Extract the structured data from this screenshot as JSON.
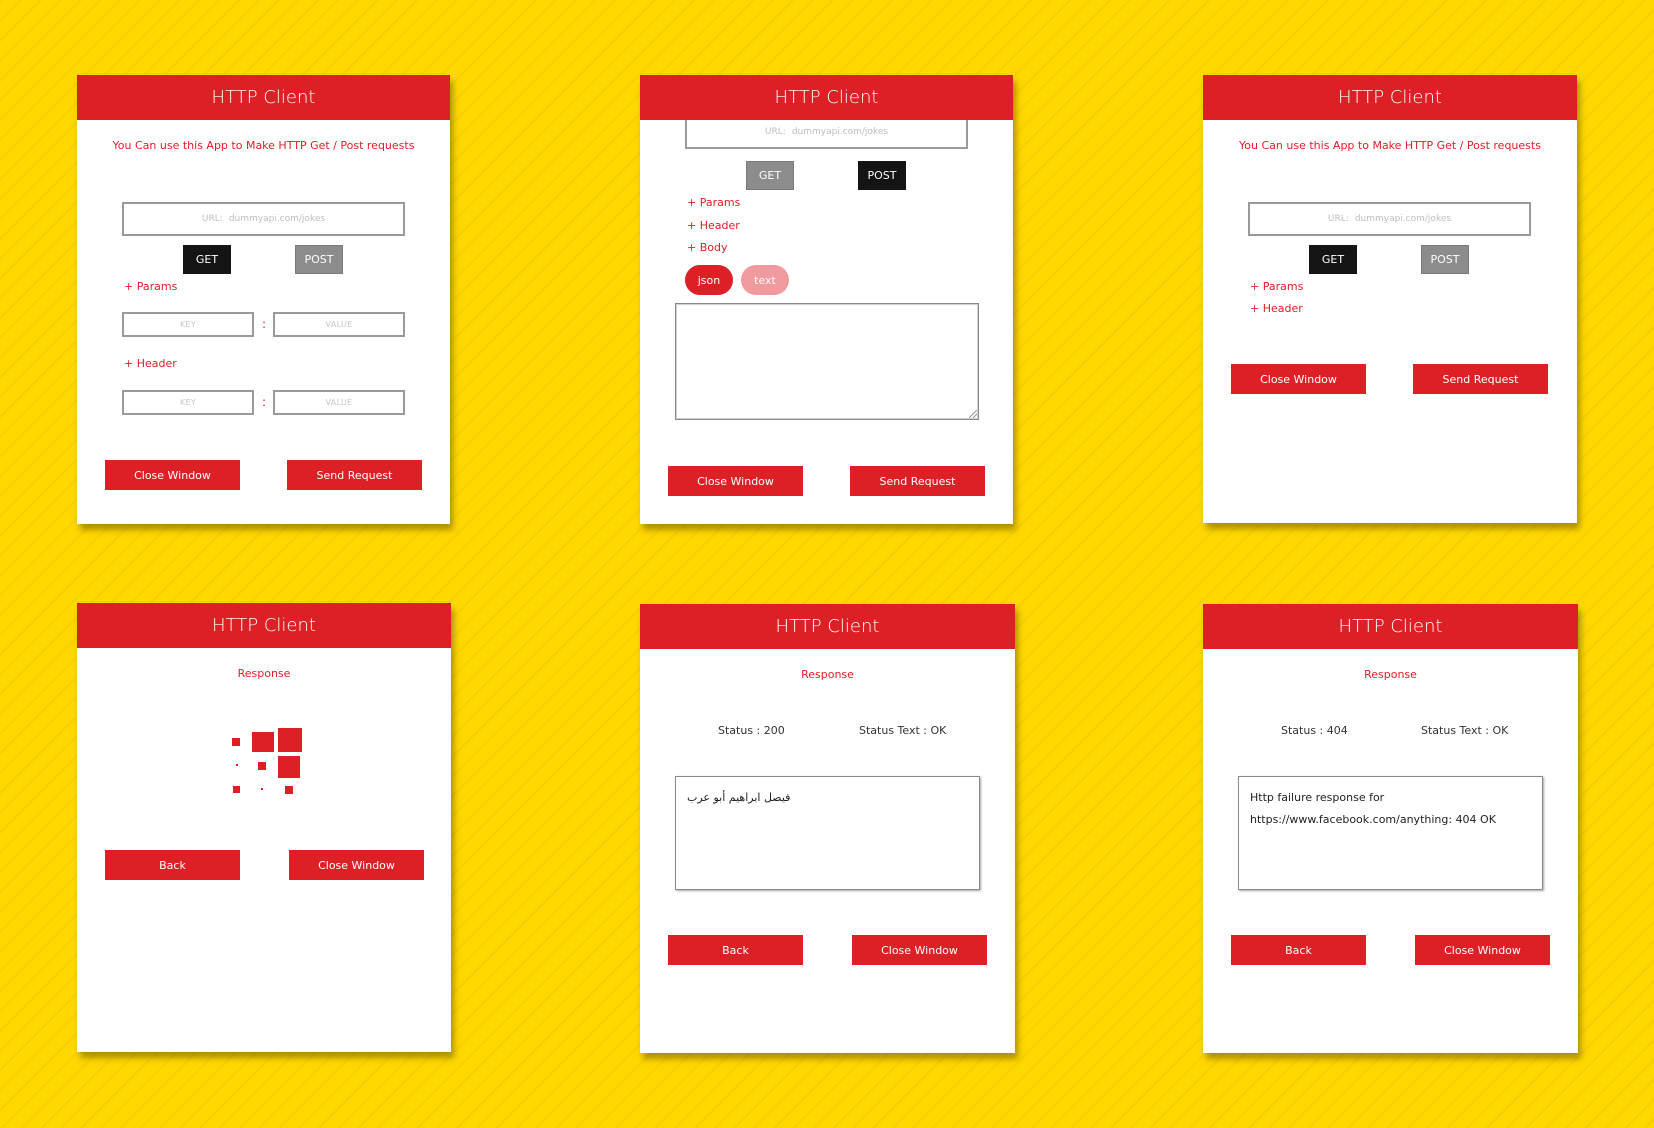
{
  "app_title": "HTTP Client",
  "intro_text": "You Can use this App to Make HTTP Get / Post requests",
  "url_placeholder_label": "URL:",
  "url_placeholder_value": "dummyapi.com/jokes",
  "methods": {
    "get": "GET",
    "post": "POST"
  },
  "sections": {
    "params": "+ Params",
    "header": "+ Header",
    "body": "+ Body"
  },
  "kv": {
    "key": "KEY",
    "value": "VALUE",
    "separator": ":"
  },
  "body_types": {
    "json": "json",
    "text": "text"
  },
  "buttons": {
    "close_window": "Close Window",
    "send_request": "Send Request",
    "back": "Back"
  },
  "response_title": "Response",
  "success": {
    "status": "Status : 200",
    "status_text": "Status Text : OK",
    "body": "فيصل ابراهيم أبو عرب"
  },
  "failure": {
    "status": "Status : 404",
    "status_text": "Status Text : OK",
    "body_line1": "Http failure response for",
    "body_line2": "https://www.facebook.com/anything: 404 OK"
  },
  "colors": {
    "background": "#ffd800",
    "accent": "#dd1f26",
    "method_active": "#141414",
    "method_inactive": "#8c8c8c",
    "pill_inactive": "#f09a9d"
  }
}
